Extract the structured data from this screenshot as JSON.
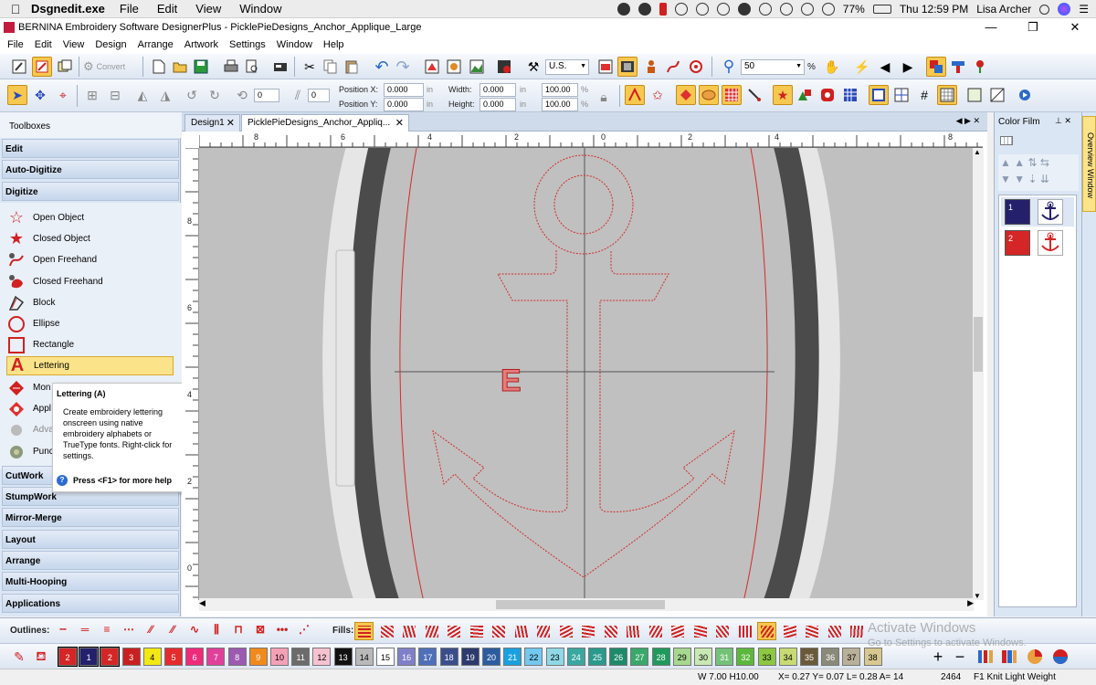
{
  "mac_menubar": {
    "app_name": "Dsgnedit.exe",
    "menus": [
      "File",
      "Edit",
      "View",
      "Window"
    ],
    "battery": "77%",
    "clock": "Thu 12:59 PM",
    "user": "Lisa Archer"
  },
  "window": {
    "title": "BERNINA Embroidery Software DesignerPlus - PicklePieDesigns_Anchor_Applique_Large",
    "minimize": "—",
    "restore": "❐",
    "close": "✕"
  },
  "app_menu": [
    "File",
    "Edit",
    "View",
    "Design",
    "Arrange",
    "Artwork",
    "Settings",
    "Window",
    "Help"
  ],
  "toolbar1": {
    "convert_label": "Convert",
    "units_value": "U.S.",
    "zoom_value": "50",
    "zoom_unit": "%"
  },
  "toolbar2": {
    "rotate_value": "0",
    "slant_value": "0",
    "pos_x_label": "Position X:",
    "pos_y_label": "Position Y:",
    "pos_x_value": "0.000",
    "pos_y_value": "0.000",
    "width_label": "Width:",
    "height_label": "Height:",
    "width_value": "0.000",
    "height_value": "0.000",
    "unit": "in",
    "scale_w": "100.00",
    "scale_h": "100.00",
    "pct": "%"
  },
  "toolboxes": {
    "header": "Toolboxes",
    "categories_top": [
      "Edit",
      "Auto-Digitize",
      "Digitize"
    ],
    "tools": [
      {
        "label": "Open Object",
        "icon": "open-star-icon"
      },
      {
        "label": "Closed Object",
        "icon": "closed-star-icon"
      },
      {
        "label": "Open Freehand",
        "icon": "open-freehand-icon"
      },
      {
        "label": "Closed Freehand",
        "icon": "closed-freehand-icon"
      },
      {
        "label": "Block",
        "icon": "block-icon"
      },
      {
        "label": "Ellipse",
        "icon": "ellipse-icon"
      },
      {
        "label": "Rectangle",
        "icon": "rectangle-icon"
      },
      {
        "label": "Lettering",
        "icon": "lettering-icon"
      },
      {
        "label": "Mon",
        "icon": "monogram-icon"
      },
      {
        "label": "Appl",
        "icon": "applique-icon"
      },
      {
        "label": "Adva",
        "icon": "advanced-icon"
      },
      {
        "label": "Punc",
        "icon": "punchwork-icon"
      }
    ],
    "categories_bottom": [
      "CutWork",
      "StumpWork",
      "Mirror-Merge",
      "Layout",
      "Arrange",
      "Multi-Hooping",
      "Applications"
    ]
  },
  "tooltip": {
    "title": "Lettering (A)",
    "body": "Create embroidery lettering onscreen using native embroidery alphabets or TrueType fonts. Right-click for settings.",
    "footer": "Press <F1> for more help"
  },
  "tabs": [
    {
      "label": "Design1"
    },
    {
      "label": "PicklePieDesigns_Anchor_Appliq..."
    }
  ],
  "ruler": {
    "h_labels": [
      "8",
      "6",
      "4",
      "2",
      "0",
      "2",
      "4",
      "8"
    ],
    "v_labels": [
      "8",
      "6",
      "4",
      "2",
      "0"
    ]
  },
  "canvas": {
    "letter": "E",
    "outline_color": "#d42a2a",
    "hoop_color": "#4b4b4b",
    "background_color": "#c0c0c0"
  },
  "color_film": {
    "title": "Color Film",
    "items": [
      {
        "num": "1",
        "color": "#25206b"
      },
      {
        "num": "2",
        "color": "#d42626"
      }
    ]
  },
  "overview": {
    "label": "Overview Window"
  },
  "bottom_toolbar": {
    "outlines_label": "Outlines:",
    "fills_label": "Fills:"
  },
  "palette": [
    {
      "num": "2",
      "color": "#d42626"
    },
    {
      "num": "1",
      "color": "#25206b"
    },
    {
      "num": "2",
      "color": "#d42626"
    },
    {
      "num": "3",
      "color": "#c82020"
    },
    {
      "num": "4",
      "color": "#f3e812"
    },
    {
      "num": "5",
      "color": "#e52b2b"
    },
    {
      "num": "6",
      "color": "#ee2a7b"
    },
    {
      "num": "7",
      "color": "#e0409a"
    },
    {
      "num": "8",
      "color": "#9c5ab0"
    },
    {
      "num": "9",
      "color": "#f08a1c"
    },
    {
      "num": "10",
      "color": "#f4a0b5"
    },
    {
      "num": "11",
      "color": "#6b6b6b"
    },
    {
      "num": "12",
      "color": "#f5c2d0"
    },
    {
      "num": "13",
      "color": "#111111"
    },
    {
      "num": "14",
      "color": "#b9b9b9"
    },
    {
      "num": "15",
      "color": "#ffffff"
    },
    {
      "num": "16",
      "color": "#8080c8"
    },
    {
      "num": "17",
      "color": "#4f6fb8"
    },
    {
      "num": "18",
      "color": "#3b4e8c"
    },
    {
      "num": "19",
      "color": "#2c3a6e"
    },
    {
      "num": "20",
      "color": "#2c5ca0"
    },
    {
      "num": "21",
      "color": "#1aa0e0"
    },
    {
      "num": "22",
      "color": "#72c8ee"
    },
    {
      "num": "23",
      "color": "#8fd8e6"
    },
    {
      "num": "24",
      "color": "#3aa8a0"
    },
    {
      "num": "25",
      "color": "#2a9a8c"
    },
    {
      "num": "26",
      "color": "#1f8a6a"
    },
    {
      "num": "27",
      "color": "#3aa86a"
    },
    {
      "num": "28",
      "color": "#1f9a5c"
    },
    {
      "num": "29",
      "color": "#a6d890"
    },
    {
      "num": "30",
      "color": "#c8e8b4"
    },
    {
      "num": "31",
      "color": "#74c278"
    },
    {
      "num": "32",
      "color": "#5cb83c"
    },
    {
      "num": "33",
      "color": "#8cc840"
    },
    {
      "num": "34",
      "color": "#c8da74"
    },
    {
      "num": "35",
      "color": "#6a5a3a"
    },
    {
      "num": "36",
      "color": "#8a8a7a"
    },
    {
      "num": "37",
      "color": "#b8b098"
    },
    {
      "num": "38",
      "color": "#d8c890"
    }
  ],
  "watermark": {
    "line1": "Activate Windows",
    "line2": "Go to Settings to activate Windows."
  },
  "status": {
    "dims": "W 7.00 H10.00",
    "coords": "X= 0.27 Y= 0.07 L= 0.28 A= 14",
    "stitches": "2464",
    "fabric": "F1 Knit Light Weight"
  }
}
